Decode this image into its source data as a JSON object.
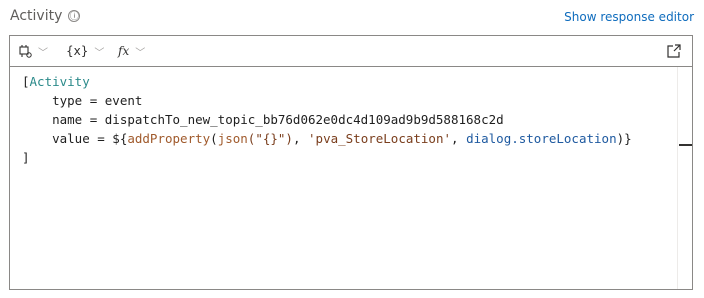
{
  "header": {
    "title": "Activity",
    "help_icon": "ⓘ",
    "link_label": "Show response editor"
  },
  "toolbar": {
    "entity_icon": "entity-icon",
    "variables_label": "{x}",
    "formula_label": "fx"
  },
  "code": {
    "line1_bracket": "[",
    "line1_keyword": "Activity",
    "line2": "    type = event",
    "line3": "    name = dispatchTo_new_topic_bb76d062e0dc4d109ad9b9d588168c2d",
    "line4_prefix": "    value = ${",
    "line4_fn1": "addProperty",
    "line4_p1": "(",
    "line4_fn2": "json",
    "line4_str1": "(\"{}\")",
    "line4_comma1": ", ",
    "line4_str2": "'pva_StoreLocation'",
    "line4_comma2": ", ",
    "line4_prop": "dialog.storeLocation",
    "line4_suffix": ")}",
    "line5": "]"
  },
  "colors": {
    "keyword": "#2b8a8a",
    "function": "#a05a2c",
    "string": "#7a3e1d",
    "property": "#1f5aa0",
    "link": "#0f6cbd"
  }
}
